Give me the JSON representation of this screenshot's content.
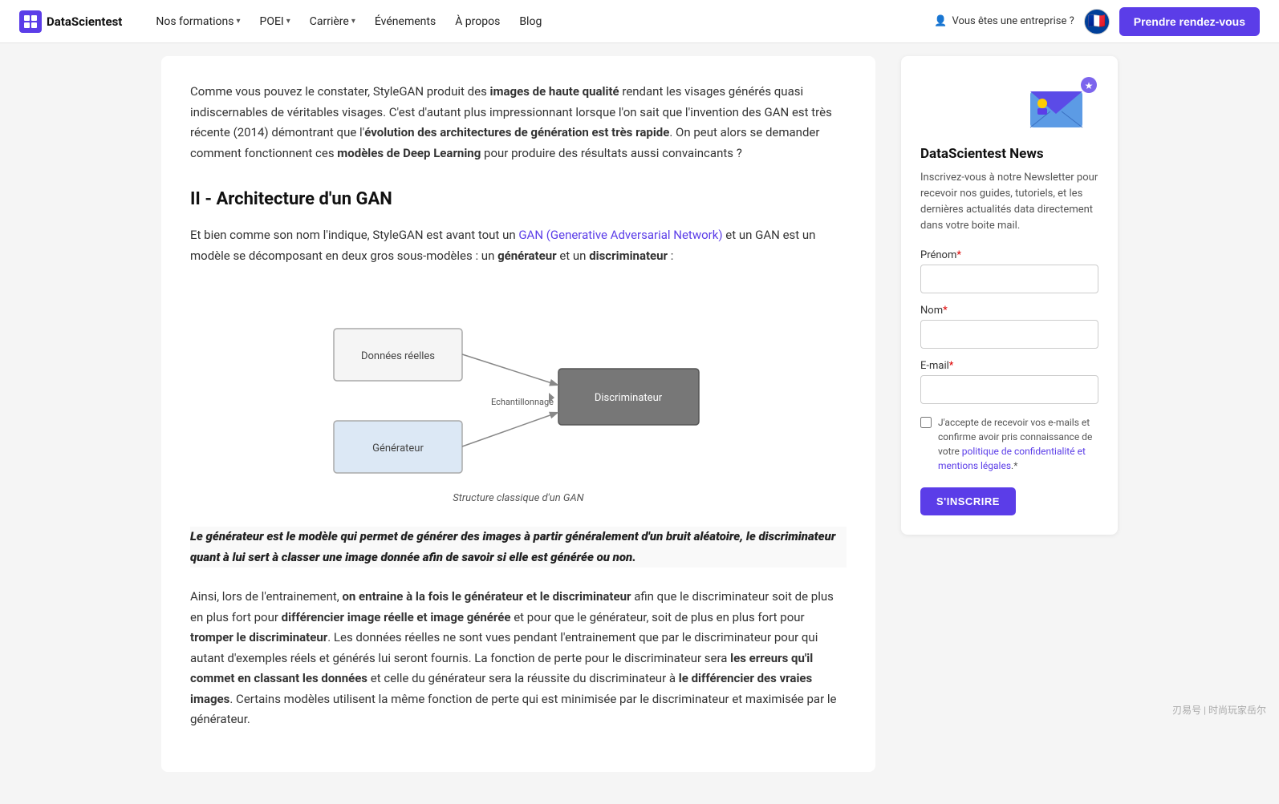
{
  "navbar": {
    "logo_text": "DataScientest",
    "nav_items": [
      {
        "label": "Nos formations",
        "has_dropdown": true
      },
      {
        "label": "POEI",
        "has_dropdown": true
      },
      {
        "label": "Carrière",
        "has_dropdown": true
      },
      {
        "label": "Événements",
        "has_dropdown": false
      },
      {
        "label": "À propos",
        "has_dropdown": false
      },
      {
        "label": "Blog",
        "has_dropdown": false
      }
    ],
    "enterprise_label": "Vous êtes une entreprise ?",
    "cta_label": "Prendre rendez-vous",
    "lang": "🇫🇷"
  },
  "main": {
    "intro_paragraph": "Comme vous pouvez le constater, StyleGAN produit des images de haute qualité rendant les visages générés quasi indiscernables de véritables visages. C'est d'autant plus impressionnant lorsque l'on sait que l'invention des GAN est très récente (2014) démontrant que l'évolution des architectures de génération est très rapide. On peut alors se demander comment fonctionnent ces modèles de Deep Learning pour produire des résultats aussi convaincants ?",
    "section_title": "II - Architecture d'un GAN",
    "body_paragraph_1_prefix": "Et bien comme son nom l'indique, StyleGAN est avant tout un ",
    "body_paragraph_1_link_text": "GAN (Generative Adversarial Network)",
    "body_paragraph_1_link_url": "#",
    "body_paragraph_1_suffix": " et un GAN est un modèle se décomposant en deux gros sous-modèles : un générateur et un discriminateur :",
    "diagram_caption": "Structure classique d'un GAN",
    "quote": "Le générateur est le modèle qui permet de générer des images à partir généralement d'un bruit aléatoire, le discriminateur quant à lui sert à classer une image donnée afin de savoir si elle est générée ou non.",
    "body_paragraph_2": "Ainsi, lors de l'entrainement, on entraine à la fois le générateur et le discriminateur afin que le discriminateur soit de plus en plus fort pour différencier image réelle et image générée et pour que le générateur, soit de plus en plus fort pour tromper le discriminateur. Les données réelles ne sont vues pendant l'entrainement que par le discriminateur pour qui autant d'exemples réels et générés lui seront fournis. La fonction de perte pour le discriminateur sera les erreurs qu'il commet en classant les données et celle du générateur sera la réussite du discriminateur à le différencier des vraies images. Certains modèles utilisent la même fonction de perte qui est minimisée par le discriminateur et maximisée par le générateur."
  },
  "sidebar": {
    "newsletter_title": "DataScientest News",
    "newsletter_desc": "Inscrivez-vous à notre Newsletter pour recevoir nos guides, tutoriels, et les dernières actualités data directement dans votre boite mail.",
    "prenom_label": "Prénom",
    "nom_label": "Nom",
    "email_label": "E-mail",
    "required_marker": "*",
    "checkbox_text": "J'accepte de recevoir vos e-mails et confirme avoir pris connaissance de votre politique de confidentialité et mentions légales.",
    "subscribe_label": "S'INSCRIRE"
  },
  "watermark": {
    "text": "刃易号 | 时尚玩家岳尔"
  }
}
